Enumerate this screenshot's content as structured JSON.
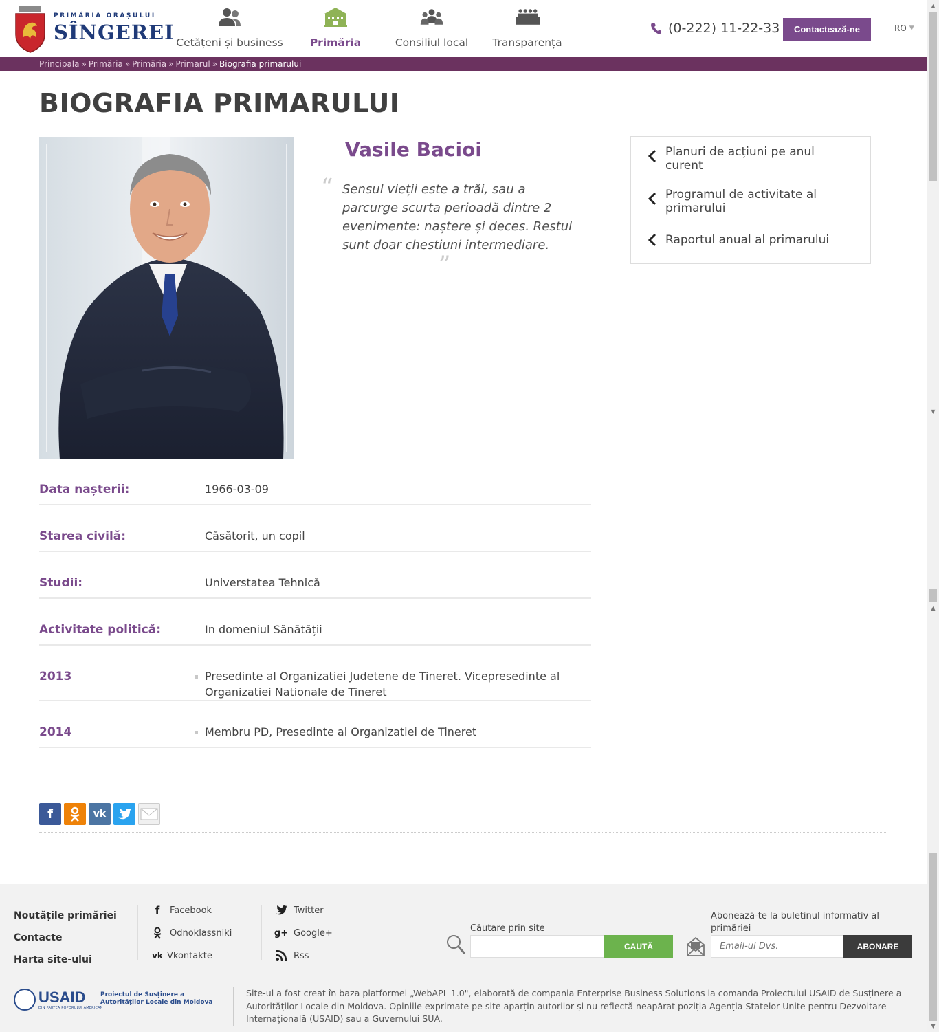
{
  "header": {
    "logo_small": "PRIMĂRIA ORAȘULUI",
    "logo_big": "SÎNGEREI",
    "nav": [
      {
        "label": "Cetățeni și business",
        "icon": "people-icon"
      },
      {
        "label": "Primăria",
        "icon": "building-icon"
      },
      {
        "label": "Consiliul local",
        "icon": "council-icon"
      },
      {
        "label": "Transparența",
        "icon": "meeting-icon"
      }
    ],
    "phone": "(0-222) 11-22-33",
    "contact_label": "Contactează-ne",
    "lang": "RO",
    "accent_color": "#7a4a8c",
    "bar_color": "#6b325f"
  },
  "breadcrumb": {
    "items": [
      "Principala",
      "Primăria",
      "Primăria",
      "Primarul"
    ],
    "separator": "»",
    "current": "Biografia primarului"
  },
  "main": {
    "title": "BIOGRAFIA PRIMARULUI",
    "name": "Vasile Bacioi",
    "quote": "Sensul vieții este a trăi, sau a parcurge scurta perioadă dintre 2 evenimente: naștere și deces. Restul sunt doar chestiuni intermediare.",
    "info": [
      {
        "label": "Data nașterii:",
        "value": "1966-03-09"
      },
      {
        "label": "Starea civilă:",
        "value": "Căsătorit, un copil"
      },
      {
        "label": "Studii:",
        "value": "Universtatea Tehnică"
      },
      {
        "label": "Activitate politică:",
        "value": "In domeniul Sănătății"
      },
      {
        "label": "2013",
        "value": "Presedinte al Organizatiei Judetene de Tineret. Vicepresedinte al Organizatiei Nationale de Tineret"
      },
      {
        "label": "2014",
        "value": "Membru PD, Presedinte al Organizatiei de Tineret"
      }
    ],
    "share": [
      "facebook",
      "odnoklassniki",
      "vkontakte",
      "twitter",
      "email"
    ]
  },
  "sidebar": {
    "links": [
      "Planuri de acțiuni pe anul curent",
      "Programul de activitate al primarului",
      "Raportul anual al primarului"
    ]
  },
  "footer": {
    "links": [
      "Noutățile primăriei",
      "Contacte",
      "Harta site-ului"
    ],
    "social_col1": [
      "Facebook",
      "Odnoklassniki",
      "Vkontakte"
    ],
    "social_col2": [
      "Twitter",
      "Google+",
      "Rss"
    ],
    "search_label": "Căutare prin site",
    "search_placeholder": "",
    "search_button": "CAUTĂ",
    "subscribe_label": "Abonează-te la buletinul informativ al primăriei",
    "subscribe_placeholder": "Email-ul Dvs.",
    "subscribe_button": "ABONARE",
    "usaid": "USAID",
    "usaid_sub": "DIN PARTEA POPORULUI AMERICAN",
    "usaid_project": "Proiectul de Susținere a Autorităților Locale din Moldova",
    "note": "Site-ul a fost creat în baza platformei „WebAPL 1.0\", elaborată de compania Enterprise Business Solutions la comanda Proiectului USAID de Susținere a Autorităților Locale din Moldova. Opiniile exprimate pe site aparțin autorilor și nu reflectă neapărat poziția Agenția Statelor Unite pentru Dezvoltare Internațională (USAID) sau a Guvernului SUA."
  }
}
